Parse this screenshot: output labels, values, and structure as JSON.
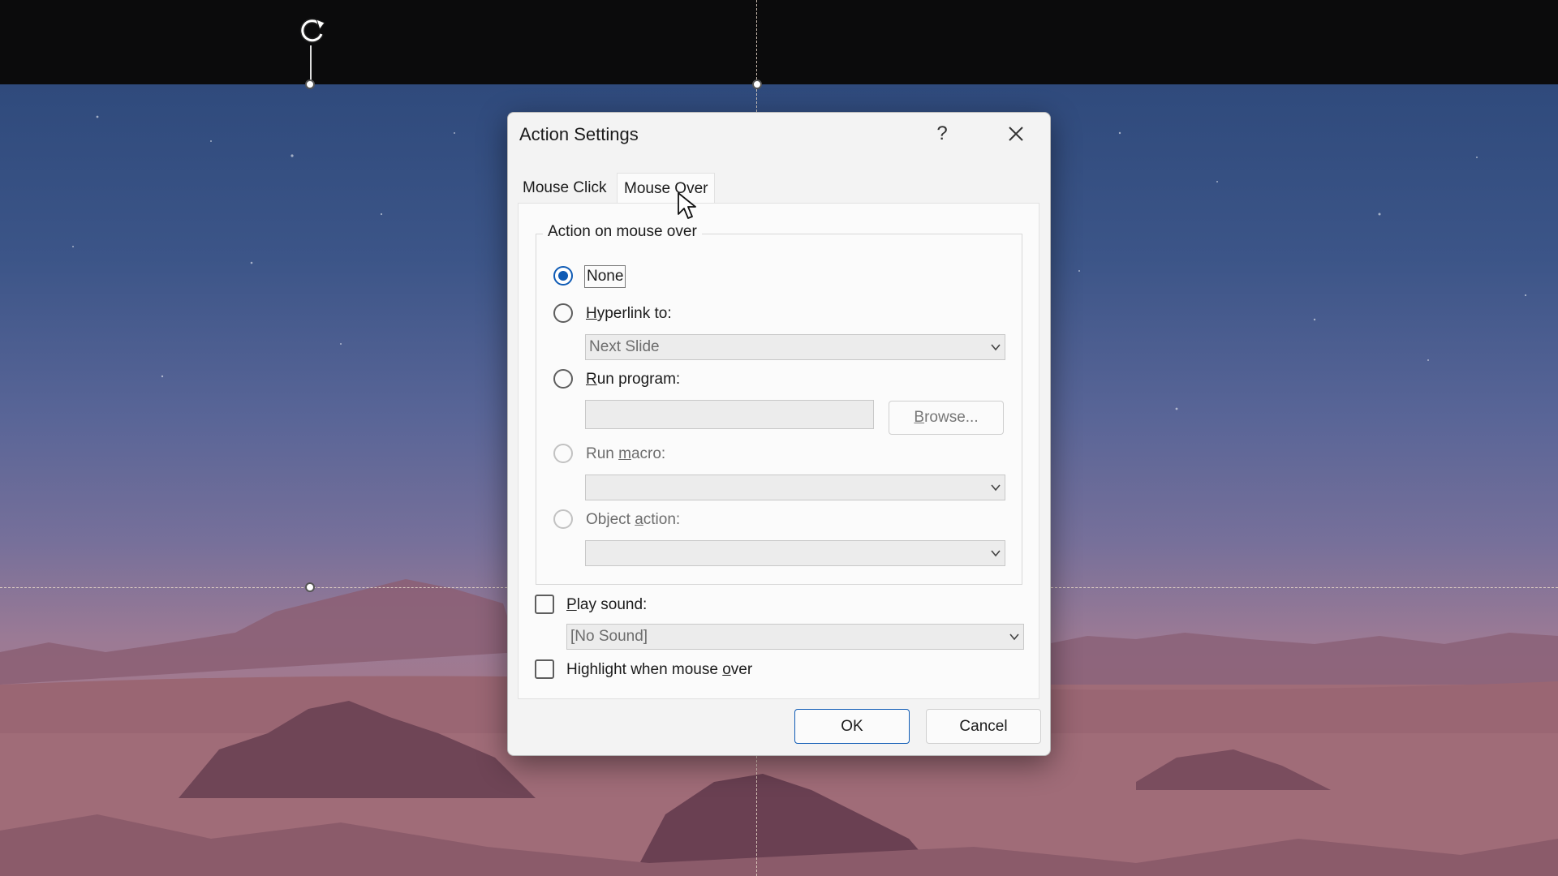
{
  "dialog": {
    "title": "Action Settings",
    "help_label": "?",
    "close_label": "✕"
  },
  "tabs": [
    {
      "label": "Mouse Click",
      "selected": false
    },
    {
      "label": "Mouse Over",
      "selected": true
    }
  ],
  "group": {
    "legend": "Action on mouse over"
  },
  "options": {
    "none": {
      "label": "None",
      "selected": true
    },
    "hyperlink": {
      "label_pre": "",
      "label_key": "H",
      "label_post": "yperlink to:",
      "combo_value": "Next Slide"
    },
    "run_program": {
      "label_key": "R",
      "label_post": "un program:",
      "input_value": "",
      "browse_key": "B",
      "browse_post": "rowse..."
    },
    "run_macro": {
      "label_pre": "Run ",
      "label_key": "m",
      "label_post": "acro:",
      "combo_value": ""
    },
    "object_action": {
      "label_pre": "Object ",
      "label_key": "a",
      "label_post": "ction:",
      "combo_value": ""
    }
  },
  "sound": {
    "label_key": "P",
    "label_post": "lay sound:",
    "combo_value": "[No Sound]",
    "checked": false
  },
  "highlight": {
    "label_pre": "Highlight when mouse ",
    "label_key": "o",
    "label_post": "ver",
    "checked": false
  },
  "buttons": {
    "ok": "OK",
    "cancel": "Cancel"
  },
  "colors": {
    "accent": "#0f5bb5"
  }
}
